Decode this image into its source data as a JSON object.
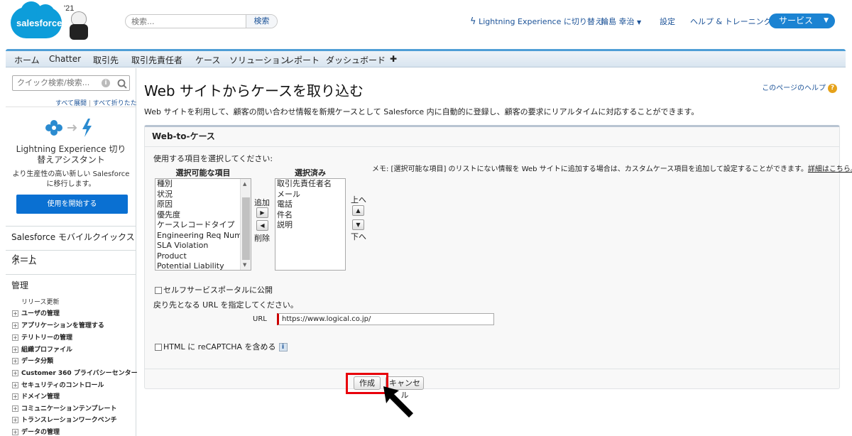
{
  "header": {
    "logo_text": "salesforce",
    "mascot_year": "'21",
    "search_placeholder": "検索...",
    "search_button": "検索",
    "switch_lightning": "Lightning Experience に切り替え",
    "user_name": "輪島 幸治",
    "setup": "設定",
    "help_training": "ヘルプ & トレーニング",
    "app_menu": "サービス"
  },
  "tabs": [
    "ホーム",
    "Chatter",
    "取引先",
    "取引先責任者",
    "ケース",
    "ソリューション",
    "レポート",
    "ダッシュボード",
    "✚"
  ],
  "sidebar": {
    "quick_search_placeholder": "クイック検索/検索...",
    "expand_all": "すべて展開",
    "collapse_all": "すべて折りたたむ",
    "lightning_title": "Lightning Experience 切り替えアシスタント",
    "lightning_sub": "より生産性の高い新しい Salesforce に移行します。",
    "lightning_button": "使用を開始する",
    "mobile_quickstart": "Salesforce モバイルクイックスタート",
    "home": "ホーム",
    "admin": "管理",
    "release_updates": "リリース更新",
    "items": [
      "ユーザの管理",
      "アプリケーションを管理する",
      "テリトリーの管理",
      "組織プロファイル",
      "データ分類",
      "Customer 360 プライバシーセンター",
      "セキュリティのコントロール",
      "ドメイン管理",
      "コミュニケーションテンプレート",
      "トランスレーションワークベンチ",
      "データの管理"
    ]
  },
  "main": {
    "title": "Web サイトからケースを取り込む",
    "help_link": "このページのヘルプ",
    "description": "Web サイトを利用して、顧客の問い合わせ情報を新規ケースとして Salesforce 内に自動的に登録し、顧客の要求にリアルタイムに対応することができます。",
    "panel_title": "Web-to-ケース",
    "instruction": "使用する項目を選択してください:",
    "available_header": "選択可能な項目",
    "selected_header": "選択済み",
    "available_items": [
      "種別",
      "状況",
      "原因",
      "優先度",
      "ケースレコードタイプ",
      "Engineering Req Number",
      "SLA Violation",
      "Product",
      "Potential Liability"
    ],
    "selected_items": [
      "取引先責任者名",
      "メール",
      "電話",
      "件名",
      "説明"
    ],
    "add_label": "追加",
    "remove_label": "削除",
    "up_label": "上へ",
    "down_label": "下へ",
    "memo_text": "メモ: [選択可能な項目] のリストにない情報を Web サイトに追加する場合は、カスタムケース項目を追加して設定することができます。",
    "memo_link": "詳細はこちら。",
    "self_service_label": "セルフサービスポータルに公開",
    "return_url_instruction": "戻り先となる URL を指定してください。",
    "url_label": "URL",
    "url_value": "https://www.logical.co.jp/",
    "recaptcha_label": "HTML に reCAPTCHA を含める",
    "create_button": "作成",
    "cancel_button": "キャンセル"
  },
  "colors": {
    "accent": "#1b83d2",
    "tab_border": "#4f9ed6",
    "highlight": "#e8000b",
    "lightning_button": "#0a70d2"
  }
}
